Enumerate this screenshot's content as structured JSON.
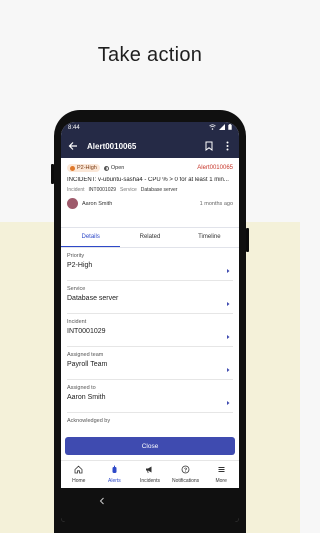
{
  "headline": "Take action",
  "status_bar": {
    "time": "8:44"
  },
  "app_bar": {
    "title": "Alert0010065"
  },
  "summary": {
    "priority_badge": "P2-High",
    "state": "Open",
    "number": "Alert0010065",
    "short_description": "INCIDENT: v-ubuntu-sasha4 - CPU % > 0 for at least 1 min...",
    "incident_label": "Incident",
    "incident_value": "INT0001029",
    "service_label": "Service",
    "service_value": "Database server",
    "user_name": "Aaron Smith",
    "time_ago": "1 months ago"
  },
  "tabs": [
    {
      "label": "Details",
      "active": true
    },
    {
      "label": "Related",
      "active": false
    },
    {
      "label": "Timeline",
      "active": false
    }
  ],
  "fields": [
    {
      "label": "Priority",
      "value": "P2-High"
    },
    {
      "label": "Service",
      "value": "Database server"
    },
    {
      "label": "Incident",
      "value": "INT0001029"
    },
    {
      "label": "Assigned team",
      "value": "Payroll Team"
    },
    {
      "label": "Assigned to",
      "value": "Aaron Smith"
    },
    {
      "label": "Acknowledged by",
      "value": ""
    }
  ],
  "close_button": "Close",
  "bottom_nav": [
    {
      "label": "Home",
      "icon": "home-icon"
    },
    {
      "label": "Alerts",
      "icon": "alerts-icon",
      "active": true
    },
    {
      "label": "Incidents",
      "icon": "incidents-icon"
    },
    {
      "label": "Notifications",
      "icon": "notifications-icon"
    },
    {
      "label": "More",
      "icon": "more-icon"
    }
  ],
  "colors": {
    "brand_dark": "#252a46",
    "accent": "#2e49c8",
    "button": "#3f4bb0",
    "alert_red": "#c7352a",
    "priority_orange": "#e0792b"
  }
}
